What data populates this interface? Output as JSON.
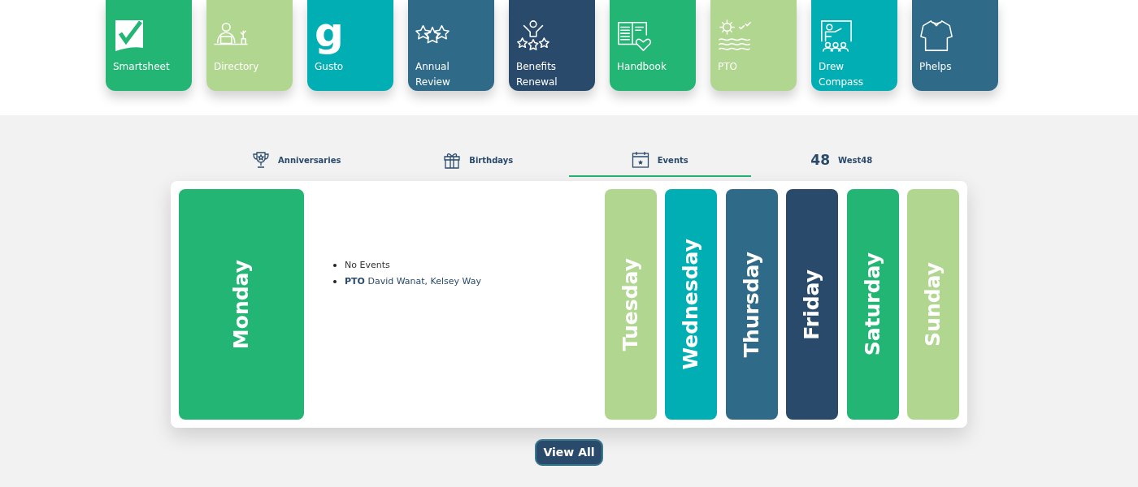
{
  "apps": [
    {
      "label": "Smartsheet",
      "color": "#22b573"
    },
    {
      "label": "Directory",
      "color": "#b0d68f"
    },
    {
      "label": "Gusto",
      "kind": "text-logo",
      "logo_text": "g",
      "color": "#00aeb3"
    },
    {
      "label": "Annual Review",
      "color": "#2f6b88"
    },
    {
      "label": "Benefits Renewal",
      "color": "#2a4a6b"
    },
    {
      "label": "Handbook",
      "color": "#22b573"
    },
    {
      "label": "PTO",
      "color": "#b0d68f"
    },
    {
      "label": "Drew Compass",
      "color": "#00aeb3"
    },
    {
      "label": "Phelps",
      "color": "#2f6b88"
    }
  ],
  "tabs": [
    {
      "label": "Anniversaries",
      "selected": false
    },
    {
      "label": "Birthdays",
      "selected": false
    },
    {
      "label": "Events",
      "selected": true
    },
    {
      "label": "West48",
      "kind": "text-logo",
      "icon_text": "48",
      "selected": false
    }
  ],
  "days": [
    {
      "label": "Monday",
      "color": "#22b573",
      "selected": true
    },
    {
      "label": "Tuesday",
      "color": "#b0d68f",
      "selected": false
    },
    {
      "label": "Wednesday",
      "color": "#00aeb3",
      "selected": false
    },
    {
      "label": "Thursday",
      "color": "#2f6b88",
      "selected": false
    },
    {
      "label": "Friday",
      "color": "#2a4a6b",
      "selected": false
    },
    {
      "label": "Saturday",
      "color": "#22b573",
      "selected": false
    },
    {
      "label": "Sunday",
      "color": "#b0d68f",
      "selected": false
    }
  ],
  "events": [
    {
      "kind": "empty",
      "text": "No Events"
    },
    {
      "kind": "event",
      "text": "**PTO** David Wanat, Kelsey Way"
    }
  ],
  "view_all": "View All"
}
